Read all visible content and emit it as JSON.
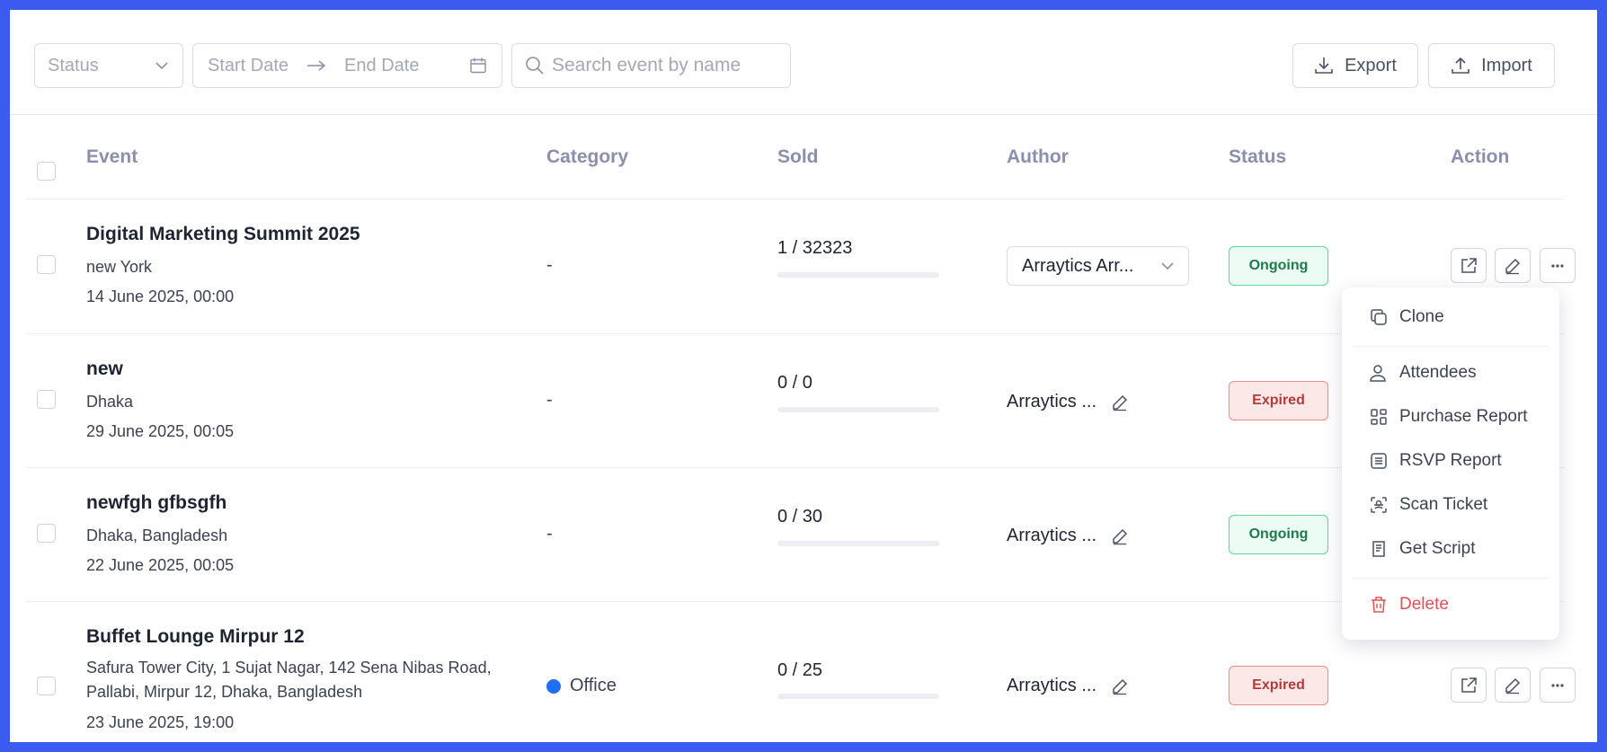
{
  "toolbar": {
    "status_placeholder": "Status",
    "start_date_placeholder": "Start Date",
    "end_date_placeholder": "End Date",
    "search_placeholder": "Search event by name",
    "export_label": "Export",
    "import_label": "Import"
  },
  "table": {
    "headers": {
      "event": "Event",
      "category": "Category",
      "sold": "Sold",
      "author": "Author",
      "status": "Status",
      "action": "Action"
    },
    "rows": [
      {
        "title": "Digital Marketing Summit 2025",
        "location": "new York",
        "date": "14 June 2025, 00:00",
        "category": "-",
        "sold": "1 / 32323",
        "sold_fraction": 3e-05,
        "author": "Arraytics Arr...",
        "status": "Ongoing"
      },
      {
        "title": "new",
        "location": "Dhaka",
        "date": "29 June 2025, 00:05",
        "category": "-",
        "sold": "0 / 0",
        "sold_fraction": 0,
        "author": "Arraytics ...",
        "status": "Expired"
      },
      {
        "title": "newfgh gfbsgfh",
        "location": "Dhaka, Bangladesh",
        "date": "22 June 2025, 00:05",
        "category": "-",
        "sold": "0 / 30",
        "sold_fraction": 0,
        "author": "Arraytics ...",
        "status": "Ongoing"
      },
      {
        "title": "Buffet Lounge Mirpur 12",
        "location": "Safura Tower City, 1 Sujat Nagar, 142 Sena Nibas Road, Pallabi, Mirpur 12, Dhaka, Bangladesh",
        "date": "23 June 2025, 19:00",
        "category": "Office",
        "category_color": "#1f6ff2",
        "sold": "0 / 25",
        "sold_fraction": 0,
        "author": "Arraytics ...",
        "status": "Expired"
      }
    ]
  },
  "action_menu": {
    "clone": "Clone",
    "attendees": "Attendees",
    "purchase_report": "Purchase Report",
    "rsvp_report": "RSVP Report",
    "scan_ticket": "Scan Ticket",
    "get_script": "Get Script",
    "delete": "Delete"
  },
  "colors": {
    "accent": "#3b5bf0",
    "ongoing": "#5fd69c",
    "expired": "#f08c8c",
    "danger": "#e05252"
  },
  "icons": [
    "chevron-down-icon",
    "arrow-right-icon",
    "calendar-icon",
    "search-icon",
    "download-icon",
    "upload-icon",
    "external-link-icon",
    "pencil-icon",
    "more-icon",
    "copy-icon",
    "user-icon",
    "grid-icon",
    "list-icon",
    "scan-icon",
    "script-icon",
    "trash-icon"
  ]
}
